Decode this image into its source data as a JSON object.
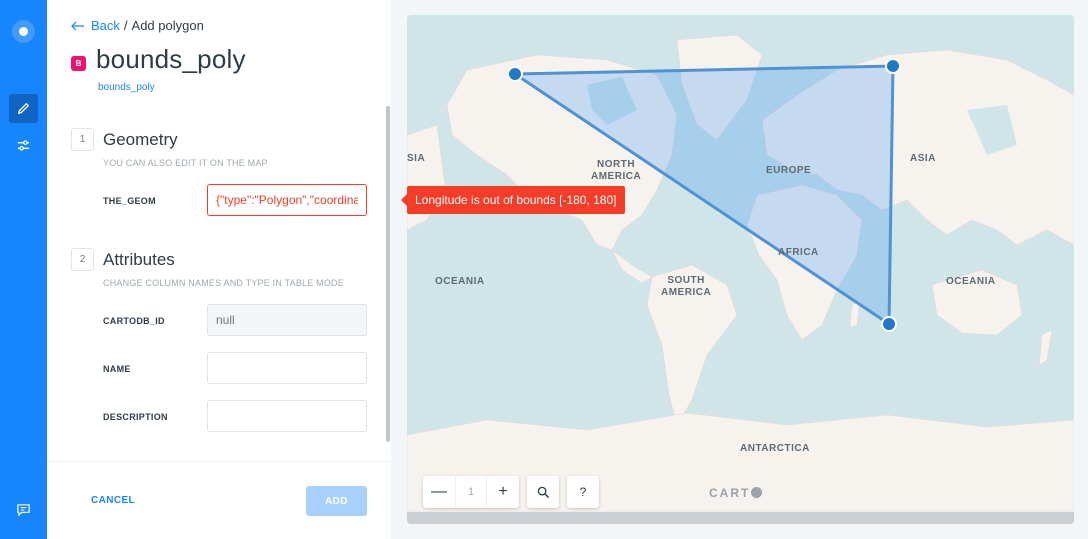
{
  "nav": {
    "back_label": "Back",
    "breadcrumb_sep": "/",
    "breadcrumb_current": "Add polygon"
  },
  "layer": {
    "badge": "B",
    "title": "bounds_poly",
    "subtitle": "bounds_poly",
    "badge_color": "#f10f6f"
  },
  "geometry": {
    "step": "1",
    "title": "Geometry",
    "hint": "YOU CAN ALSO EDIT IT ON THE MAP",
    "field_label": "THE_GEOM",
    "field_value": "{\"type\":\"Polygon\",\"coordinates\""
  },
  "attributes": {
    "step": "2",
    "title": "Attributes",
    "hint": "CHANGE COLUMN NAMES AND TYPE IN TABLE MODE",
    "fields": [
      {
        "label": "CARTODB_ID",
        "placeholder": "null",
        "value": ""
      },
      {
        "label": "NAME",
        "placeholder": "",
        "value": ""
      },
      {
        "label": "DESCRIPTION",
        "placeholder": "",
        "value": ""
      }
    ]
  },
  "footer": {
    "cancel_label": "CANCEL",
    "add_label": "ADD"
  },
  "map": {
    "error_tooltip": "Longitude is out of bounds [-180, 180]",
    "labels": {
      "asia_left": "SIA",
      "north_america": "NORTH\nAMERICA",
      "europe": "EUROPE",
      "asia": "ASIA",
      "africa": "AFRICA",
      "oceania_left": "OCEANIA",
      "south_america": "SOUTH\nAMERICA",
      "oceania_right": "OCEANIA",
      "antarctica": "ANTARCTICA"
    },
    "zoom_level": "1",
    "zoom_out_label": "—",
    "zoom_in_label": "+",
    "search_icon": "search-icon",
    "help_label": "?",
    "logo": "CART"
  },
  "colors": {
    "accent": "#1785fb",
    "error": "#f33d29",
    "polygon_fill": "rgba(23,133,251,0.25)",
    "polygon_stroke": "#4f93d4"
  }
}
